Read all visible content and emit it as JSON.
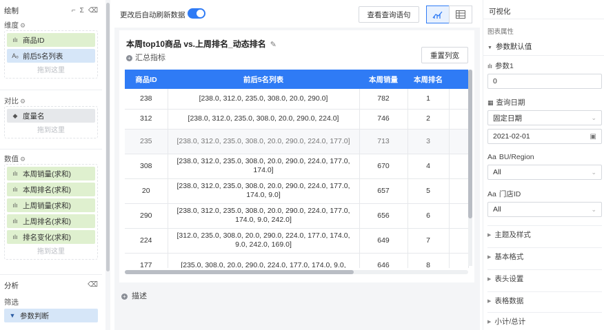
{
  "left_panel": {
    "title": "绘制",
    "dimension": {
      "label": "维度",
      "items": [
        {
          "icon": "ılı",
          "label": "商品ID"
        },
        {
          "icon": "Aₒ",
          "label": "前后5名列表"
        }
      ],
      "drop_hint": "拖到这里"
    },
    "compare": {
      "label": "对比",
      "items": [
        {
          "icon": "◆",
          "label": "度量名"
        }
      ],
      "drop_hint": "拖到这里"
    },
    "values": {
      "label": "数值",
      "items": [
        {
          "icon": "ılı",
          "label": "本周销量(求和)"
        },
        {
          "icon": "ılı",
          "label": "本周排名(求和)"
        },
        {
          "icon": "ılı",
          "label": "上周销量(求和)"
        },
        {
          "icon": "ılı",
          "label": "上周排名(求和)"
        },
        {
          "icon": "ılı",
          "label": "排名变化(求和)"
        }
      ],
      "drop_hint": "拖到这里"
    },
    "analysis": {
      "label": "分析",
      "filter_label": "筛选",
      "filter_item": "参数判断"
    }
  },
  "toolbar": {
    "auto_refresh_label": "更改后自动刷新数据",
    "auto_refresh_on": true,
    "view_query_button": "查看查询语句"
  },
  "chart": {
    "title": "本周top10商品 vs.上周排名_动态排名",
    "summary_label": "汇总指标",
    "reset_width_button": "重置列宽",
    "columns": [
      "商品ID",
      "前后5名列表",
      "本周销量",
      "本周排名"
    ],
    "rows": [
      {
        "id": "238",
        "list": "[238.0, 312.0, 235.0, 308.0, 20.0, 290.0]",
        "sales": "782",
        "rank": "1"
      },
      {
        "id": "312",
        "list": "[238.0, 312.0, 235.0, 308.0, 20.0, 290.0, 224.0]",
        "sales": "746",
        "rank": "2"
      },
      {
        "id": "235",
        "list": "[238.0, 312.0, 235.0, 308.0, 20.0, 290.0, 224.0, 177.0]",
        "sales": "713",
        "rank": "3"
      },
      {
        "id": "308",
        "list": "[238.0, 312.0, 235.0, 308.0, 20.0, 290.0, 224.0, 177.0, 174.0]",
        "sales": "670",
        "rank": "4"
      },
      {
        "id": "20",
        "list": "[238.0, 312.0, 235.0, 308.0, 20.0, 290.0, 224.0, 177.0, 174.0, 9.0]",
        "sales": "657",
        "rank": "5"
      },
      {
        "id": "290",
        "list": "[238.0, 312.0, 235.0, 308.0, 20.0, 290.0, 224.0, 177.0, 174.0, 9.0, 242.0]",
        "sales": "656",
        "rank": "6"
      },
      {
        "id": "224",
        "list": "[312.0, 235.0, 308.0, 20.0, 290.0, 224.0, 177.0, 174.0, 9.0, 242.0, 169.0]",
        "sales": "649",
        "rank": "7"
      },
      {
        "id": "177",
        "list": "[235.0, 308.0, 20.0, 290.0, 224.0, 177.0, 174.0, 9.0,",
        "sales": "646",
        "rank": "8"
      }
    ],
    "description_label": "描述"
  },
  "right_panel": {
    "title": "可视化",
    "subtitle": "图表属性",
    "param_section": "参数默认值",
    "param1_label": "参数1",
    "param1_value": "0",
    "query_date_label": "查询日期",
    "query_date_mode": "固定日期",
    "query_date_value": "2021-02-01",
    "bu_label": "BU/Region",
    "bu_prefix": "Aa",
    "bu_value": "All",
    "store_label": "门店ID",
    "store_prefix": "Aa",
    "store_value": "All",
    "sections": [
      "主题及样式",
      "基本格式",
      "表头设置",
      "表格数据",
      "小计/总计"
    ]
  },
  "colors": {
    "accent": "#2f7bf5",
    "pill_green": "#dff0cf",
    "pill_blue": "#d6e6f8"
  }
}
